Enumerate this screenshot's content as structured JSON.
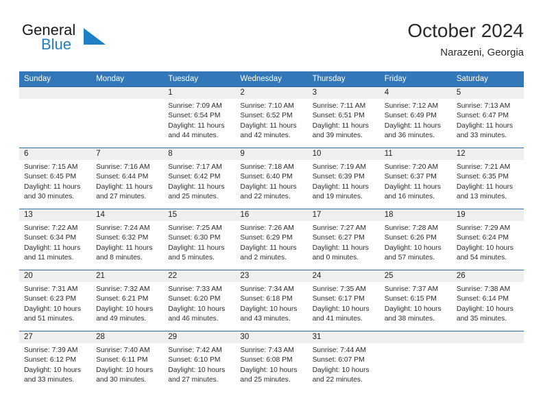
{
  "brand": {
    "word_one": "General",
    "word_two": "Blue",
    "mark": "triangle-logo",
    "color_dark": "#1a1a1a",
    "color_blue": "#1f7fc4"
  },
  "header": {
    "title": "October 2024",
    "subtitle": "Narazeni, Georgia"
  },
  "theme": {
    "header_bg": "#3277b8",
    "row_divider": "#2e6da4",
    "daynum_bg": "#efefef",
    "cell_bg": "#ffffff",
    "text": "#2b2b2b"
  },
  "weekday_headers": [
    "Sunday",
    "Monday",
    "Tuesday",
    "Wednesday",
    "Thursday",
    "Friday",
    "Saturday"
  ],
  "weeks": [
    [
      {
        "day": "",
        "sunrise": "",
        "sunset": "",
        "daylight_a": "",
        "daylight_b": ""
      },
      {
        "day": "",
        "sunrise": "",
        "sunset": "",
        "daylight_a": "",
        "daylight_b": ""
      },
      {
        "day": "1",
        "sunrise": "Sunrise: 7:09 AM",
        "sunset": "Sunset: 6:54 PM",
        "daylight_a": "Daylight: 11 hours",
        "daylight_b": "and 44 minutes."
      },
      {
        "day": "2",
        "sunrise": "Sunrise: 7:10 AM",
        "sunset": "Sunset: 6:52 PM",
        "daylight_a": "Daylight: 11 hours",
        "daylight_b": "and 42 minutes."
      },
      {
        "day": "3",
        "sunrise": "Sunrise: 7:11 AM",
        "sunset": "Sunset: 6:51 PM",
        "daylight_a": "Daylight: 11 hours",
        "daylight_b": "and 39 minutes."
      },
      {
        "day": "4",
        "sunrise": "Sunrise: 7:12 AM",
        "sunset": "Sunset: 6:49 PM",
        "daylight_a": "Daylight: 11 hours",
        "daylight_b": "and 36 minutes."
      },
      {
        "day": "5",
        "sunrise": "Sunrise: 7:13 AM",
        "sunset": "Sunset: 6:47 PM",
        "daylight_a": "Daylight: 11 hours",
        "daylight_b": "and 33 minutes."
      }
    ],
    [
      {
        "day": "6",
        "sunrise": "Sunrise: 7:15 AM",
        "sunset": "Sunset: 6:45 PM",
        "daylight_a": "Daylight: 11 hours",
        "daylight_b": "and 30 minutes."
      },
      {
        "day": "7",
        "sunrise": "Sunrise: 7:16 AM",
        "sunset": "Sunset: 6:44 PM",
        "daylight_a": "Daylight: 11 hours",
        "daylight_b": "and 27 minutes."
      },
      {
        "day": "8",
        "sunrise": "Sunrise: 7:17 AM",
        "sunset": "Sunset: 6:42 PM",
        "daylight_a": "Daylight: 11 hours",
        "daylight_b": "and 25 minutes."
      },
      {
        "day": "9",
        "sunrise": "Sunrise: 7:18 AM",
        "sunset": "Sunset: 6:40 PM",
        "daylight_a": "Daylight: 11 hours",
        "daylight_b": "and 22 minutes."
      },
      {
        "day": "10",
        "sunrise": "Sunrise: 7:19 AM",
        "sunset": "Sunset: 6:39 PM",
        "daylight_a": "Daylight: 11 hours",
        "daylight_b": "and 19 minutes."
      },
      {
        "day": "11",
        "sunrise": "Sunrise: 7:20 AM",
        "sunset": "Sunset: 6:37 PM",
        "daylight_a": "Daylight: 11 hours",
        "daylight_b": "and 16 minutes."
      },
      {
        "day": "12",
        "sunrise": "Sunrise: 7:21 AM",
        "sunset": "Sunset: 6:35 PM",
        "daylight_a": "Daylight: 11 hours",
        "daylight_b": "and 13 minutes."
      }
    ],
    [
      {
        "day": "13",
        "sunrise": "Sunrise: 7:22 AM",
        "sunset": "Sunset: 6:34 PM",
        "daylight_a": "Daylight: 11 hours",
        "daylight_b": "and 11 minutes."
      },
      {
        "day": "14",
        "sunrise": "Sunrise: 7:24 AM",
        "sunset": "Sunset: 6:32 PM",
        "daylight_a": "Daylight: 11 hours",
        "daylight_b": "and 8 minutes."
      },
      {
        "day": "15",
        "sunrise": "Sunrise: 7:25 AM",
        "sunset": "Sunset: 6:30 PM",
        "daylight_a": "Daylight: 11 hours",
        "daylight_b": "and 5 minutes."
      },
      {
        "day": "16",
        "sunrise": "Sunrise: 7:26 AM",
        "sunset": "Sunset: 6:29 PM",
        "daylight_a": "Daylight: 11 hours",
        "daylight_b": "and 2 minutes."
      },
      {
        "day": "17",
        "sunrise": "Sunrise: 7:27 AM",
        "sunset": "Sunset: 6:27 PM",
        "daylight_a": "Daylight: 11 hours",
        "daylight_b": "and 0 minutes."
      },
      {
        "day": "18",
        "sunrise": "Sunrise: 7:28 AM",
        "sunset": "Sunset: 6:26 PM",
        "daylight_a": "Daylight: 10 hours",
        "daylight_b": "and 57 minutes."
      },
      {
        "day": "19",
        "sunrise": "Sunrise: 7:29 AM",
        "sunset": "Sunset: 6:24 PM",
        "daylight_a": "Daylight: 10 hours",
        "daylight_b": "and 54 minutes."
      }
    ],
    [
      {
        "day": "20",
        "sunrise": "Sunrise: 7:31 AM",
        "sunset": "Sunset: 6:23 PM",
        "daylight_a": "Daylight: 10 hours",
        "daylight_b": "and 51 minutes."
      },
      {
        "day": "21",
        "sunrise": "Sunrise: 7:32 AM",
        "sunset": "Sunset: 6:21 PM",
        "daylight_a": "Daylight: 10 hours",
        "daylight_b": "and 49 minutes."
      },
      {
        "day": "22",
        "sunrise": "Sunrise: 7:33 AM",
        "sunset": "Sunset: 6:20 PM",
        "daylight_a": "Daylight: 10 hours",
        "daylight_b": "and 46 minutes."
      },
      {
        "day": "23",
        "sunrise": "Sunrise: 7:34 AM",
        "sunset": "Sunset: 6:18 PM",
        "daylight_a": "Daylight: 10 hours",
        "daylight_b": "and 43 minutes."
      },
      {
        "day": "24",
        "sunrise": "Sunrise: 7:35 AM",
        "sunset": "Sunset: 6:17 PM",
        "daylight_a": "Daylight: 10 hours",
        "daylight_b": "and 41 minutes."
      },
      {
        "day": "25",
        "sunrise": "Sunrise: 7:37 AM",
        "sunset": "Sunset: 6:15 PM",
        "daylight_a": "Daylight: 10 hours",
        "daylight_b": "and 38 minutes."
      },
      {
        "day": "26",
        "sunrise": "Sunrise: 7:38 AM",
        "sunset": "Sunset: 6:14 PM",
        "daylight_a": "Daylight: 10 hours",
        "daylight_b": "and 35 minutes."
      }
    ],
    [
      {
        "day": "27",
        "sunrise": "Sunrise: 7:39 AM",
        "sunset": "Sunset: 6:12 PM",
        "daylight_a": "Daylight: 10 hours",
        "daylight_b": "and 33 minutes."
      },
      {
        "day": "28",
        "sunrise": "Sunrise: 7:40 AM",
        "sunset": "Sunset: 6:11 PM",
        "daylight_a": "Daylight: 10 hours",
        "daylight_b": "and 30 minutes."
      },
      {
        "day": "29",
        "sunrise": "Sunrise: 7:42 AM",
        "sunset": "Sunset: 6:10 PM",
        "daylight_a": "Daylight: 10 hours",
        "daylight_b": "and 27 minutes."
      },
      {
        "day": "30",
        "sunrise": "Sunrise: 7:43 AM",
        "sunset": "Sunset: 6:08 PM",
        "daylight_a": "Daylight: 10 hours",
        "daylight_b": "and 25 minutes."
      },
      {
        "day": "31",
        "sunrise": "Sunrise: 7:44 AM",
        "sunset": "Sunset: 6:07 PM",
        "daylight_a": "Daylight: 10 hours",
        "daylight_b": "and 22 minutes."
      },
      {
        "day": "",
        "sunrise": "",
        "sunset": "",
        "daylight_a": "",
        "daylight_b": ""
      },
      {
        "day": "",
        "sunrise": "",
        "sunset": "",
        "daylight_a": "",
        "daylight_b": ""
      }
    ]
  ]
}
